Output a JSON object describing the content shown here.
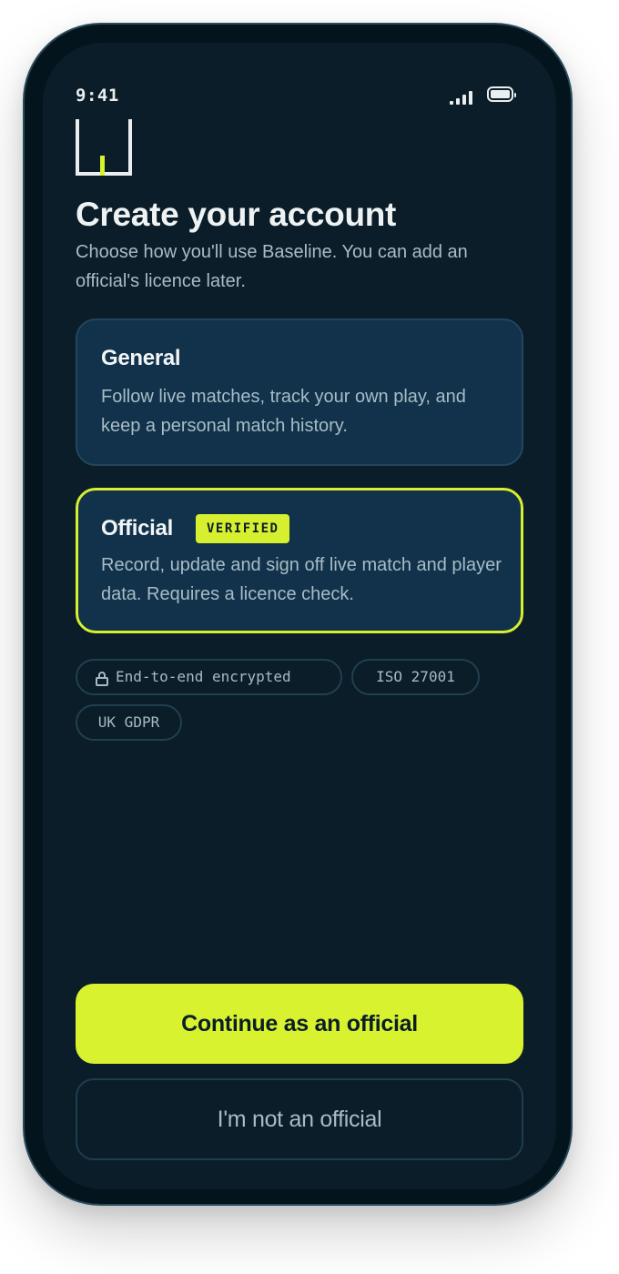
{
  "status_bar": {
    "time": "9:41",
    "signal_icon": "signal-icon",
    "battery_icon": "battery-icon"
  },
  "logo": {
    "name": "baseline-logo",
    "accent_color": "#d9f22e"
  },
  "header": {
    "title": "Create your account",
    "subtitle": "Choose how you'll use Baseline. You can add an official's licence later."
  },
  "options": [
    {
      "title": "General",
      "description": "Follow live matches, track your own play, and keep a personal match history.",
      "selected": false
    },
    {
      "title": "Official",
      "badge": "VERIFIED",
      "description": "Record, update and sign off live match and player data. Requires a licence check.",
      "selected": true
    }
  ],
  "trust_chips": [
    {
      "label": "End-to-end encrypted",
      "icon": "lock-icon"
    },
    {
      "label": "ISO 27001"
    },
    {
      "label": "UK GDPR"
    }
  ],
  "actions": {
    "primary_label": "Continue as an official",
    "secondary_label": "I'm not an official"
  },
  "colors": {
    "accent": "#d8f22f",
    "screen_bg": "#0a1d28",
    "card_bg": "#11324a",
    "text_primary": "#eef2f3",
    "text_secondary": "#a9bcc6"
  }
}
